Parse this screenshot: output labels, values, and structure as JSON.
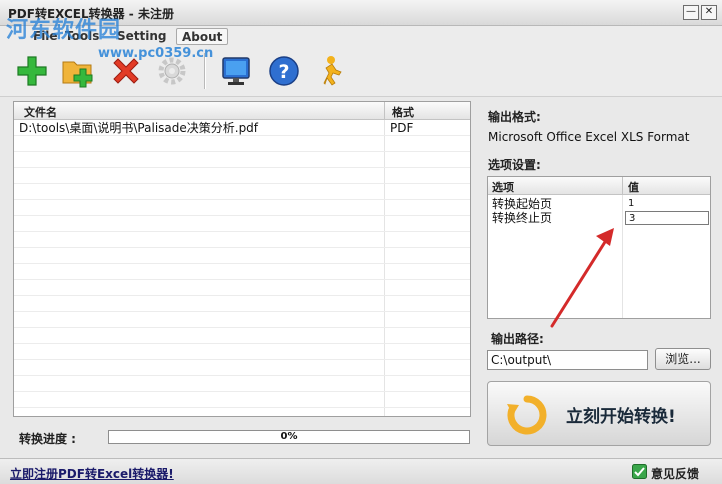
{
  "window": {
    "title": "PDF转EXCEL转换器 - 未注册",
    "min_icon": "minimize-icon",
    "close_icon": "close-icon",
    "min_glyph": "—",
    "close_glyph": "✕"
  },
  "watermark": {
    "text": "河东软件园",
    "url": "www.pc0359.cn",
    "color": "#2882d7"
  },
  "menu": {
    "items": [
      "File",
      "Tools",
      "Setting",
      "About"
    ]
  },
  "toolbar": {
    "icons": [
      "add-file-icon",
      "add-folder-icon",
      "delete-icon",
      "settings-gear-icon",
      "monitor-icon",
      "help-icon",
      "user-icon"
    ]
  },
  "filelist": {
    "columns": [
      "文件名",
      "格式"
    ],
    "rows": [
      {
        "name": "D:\\tools\\桌面\\说明书\\Palisade决策分析.pdf",
        "format": "PDF"
      }
    ]
  },
  "progress": {
    "label": "转换进度 :",
    "value": 0,
    "text": "0%"
  },
  "output_format": {
    "title": "输出格式:",
    "value": "Microsoft Office Excel XLS Format"
  },
  "options": {
    "title": "选项设置:",
    "columns": [
      "选项",
      "值"
    ],
    "rows": [
      {
        "name": "转换起始页",
        "value": "1"
      },
      {
        "name": "转换终止页",
        "value": "3"
      }
    ]
  },
  "output_path": {
    "title": "输出路径:",
    "value": "C:\\output\\",
    "browse_label": "浏览..."
  },
  "start_button": {
    "label": "立刻开始转换!"
  },
  "statusbar": {
    "register_link": "立即注册PDF转Excel转换器!",
    "feedback_label": "意见反馈"
  },
  "colors": {
    "accent_green": "#3aa64a",
    "annotation_arrow": "#d42a2a"
  }
}
